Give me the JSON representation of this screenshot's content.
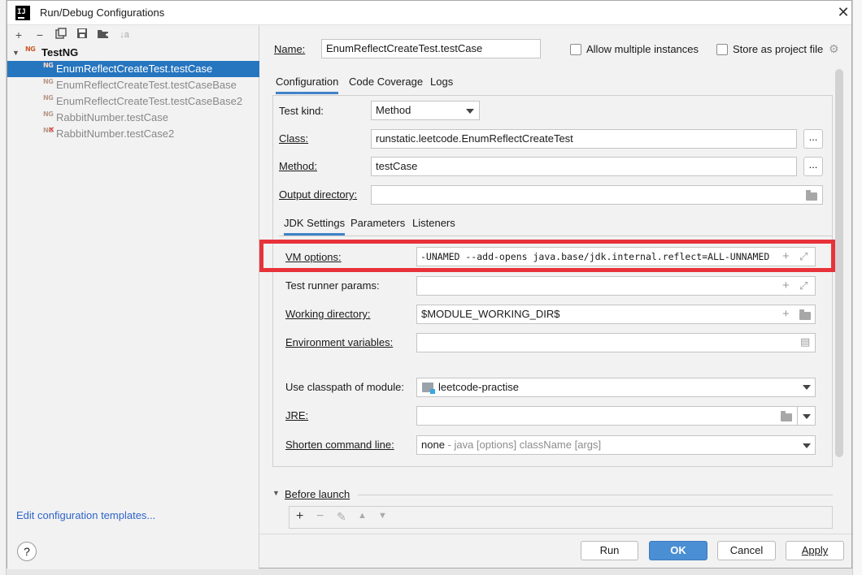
{
  "window": {
    "title": "Run/Debug Configurations"
  },
  "toolbar": {
    "add": "+",
    "remove": "−",
    "copy": "⧉",
    "save": "💾",
    "folder": "📁",
    "sort": "↓a"
  },
  "tree": {
    "root": {
      "badge": "NG",
      "label": "TestNG"
    },
    "items": [
      {
        "badge": "NG",
        "label": "EnumReflectCreateTest.testCase",
        "selected": true
      },
      {
        "badge": "NG",
        "label": "EnumReflectCreateTest.testCaseBase"
      },
      {
        "badge": "NG",
        "label": "EnumReflectCreateTest.testCaseBase2"
      },
      {
        "badge": "NG",
        "label": "RabbitNumber.testCase"
      },
      {
        "badge": "NG",
        "label": "RabbitNumber.testCase2",
        "error": true
      }
    ]
  },
  "left_footer": {
    "edit_templates": "Edit configuration templates..."
  },
  "form": {
    "name_label": "Name:",
    "name_value": "EnumReflectCreateTest.testCase",
    "allow_multiple": "Allow multiple instances",
    "store_project": "Store as project file",
    "tabs": [
      "Configuration",
      "Code Coverage",
      "Logs"
    ],
    "test_kind_label": "Test kind:",
    "test_kind_value": "Method",
    "class_label": "Class:",
    "class_value": "runstatic.leetcode.EnumReflectCreateTest",
    "method_label": "Method:",
    "method_value": "testCase",
    "output_dir_label": "Output directory:",
    "output_dir_value": "",
    "ellipsis": "...",
    "sub_tabs": [
      "JDK Settings",
      "Parameters",
      "Listeners"
    ],
    "vm_options_label": "VM options:",
    "vm_options_value": "-UNAMED --add-opens java.base/jdk.internal.reflect=ALL-UNNAMED",
    "test_runner_label": "Test runner params:",
    "test_runner_value": "",
    "working_dir_label": "Working directory:",
    "working_dir_value": "$MODULE_WORKING_DIR$",
    "env_vars_label": "Environment variables:",
    "env_vars_value": "",
    "classpath_label": "Use classpath of module:",
    "classpath_value": "leetcode-practise",
    "jre_label": "JRE:",
    "jre_value": "",
    "shorten_label": "Shorten command line:",
    "shorten_value": "none",
    "shorten_hint": " - java [options] className [args]",
    "before_launch": "Before launch",
    "bl_tools": [
      "+",
      "−",
      "✎",
      "▲",
      "▼"
    ]
  },
  "buttons": {
    "help": "?",
    "run": "Run",
    "ok": "OK",
    "cancel": "Cancel",
    "apply": "Apply"
  },
  "colors": {
    "selection": "#2675bf",
    "accent": "#4083c9",
    "highlight_box": "#e8323a",
    "primary_button": "#4a8ed3"
  }
}
